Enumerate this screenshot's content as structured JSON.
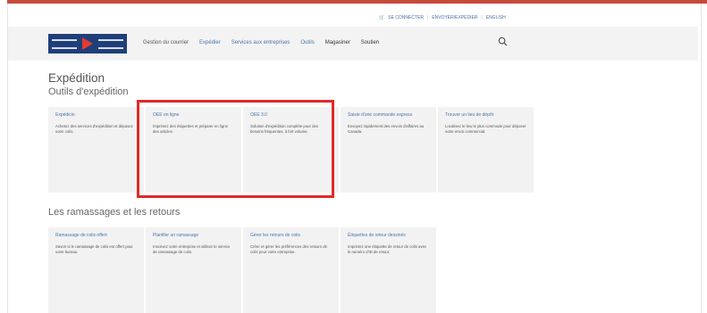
{
  "header": {
    "utility_links": [
      "SE CONNECTER",
      "ENVOYER/EXPÉDIER",
      "ENGLISH"
    ],
    "nav": [
      "Gestion du courrier",
      "Expédier",
      "Services aux entreprises",
      "Outils",
      "Magasiner",
      "Soutien"
    ]
  },
  "page": {
    "title": "Expédition",
    "section1_title": "Outils d'expédition",
    "section2_title": "Les ramassages et les retours"
  },
  "tools": [
    {
      "title": "Expédicio",
      "desc": "Achetez des services d'expédition et déposez votre colis."
    },
    {
      "title": "OEE en ligne",
      "desc": "Imprimez des étiquettes et préparer en ligne des articles."
    },
    {
      "title": "OEE 3.0",
      "desc": "Solution d'expédition complète pour des besoins fréquentes, à fort volume."
    },
    {
      "title": "Saisie d'une commande express",
      "desc": "Envoyez rapidement des envois d'affaires au Canada."
    },
    {
      "title": "Trouver un lieu de dépôt",
      "desc": "Localisez le lieu le plus commode pour déposer votre envoi commercial."
    }
  ],
  "returns": [
    {
      "title": "Ramassage de colis offert",
      "desc": "Savoir si le ramassage de colis est offert pour votre bureau."
    },
    {
      "title": "Planifier un ramassage",
      "desc": "Inscrivez votre entreprise et utilisez le service de ramassage de colis."
    },
    {
      "title": "Gérer les retours de colis",
      "desc": "Créer et gérer les préférences des retours de colis pour votre entreprise."
    },
    {
      "title": "Étiquettes de retour dessinés",
      "desc": "Imprimez une étiquette de retour de colis avec le numéro d'ID de retour."
    }
  ]
}
